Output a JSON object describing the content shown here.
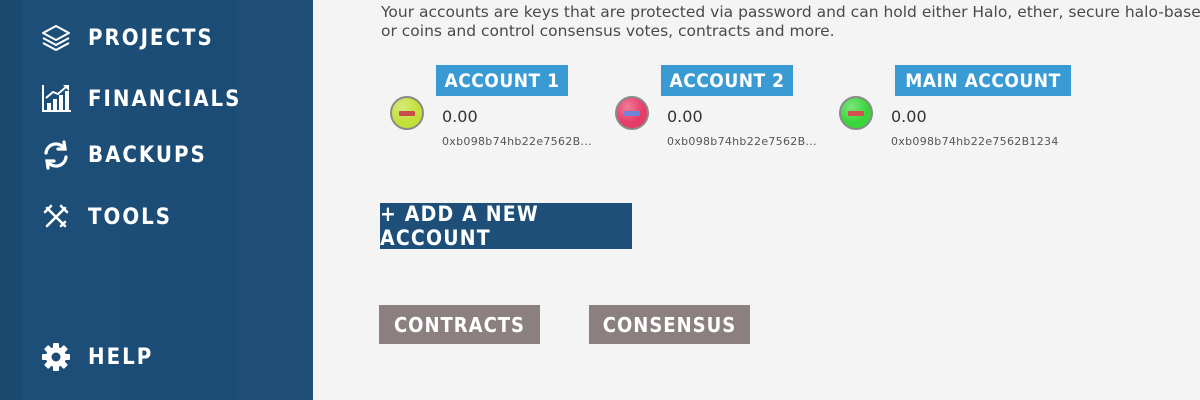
{
  "sidebar": {
    "items": [
      {
        "label": "PROJECTS",
        "icon": "layers-icon"
      },
      {
        "label": "FINANCIALS",
        "icon": "bar-chart-icon"
      },
      {
        "label": "BACKUPS",
        "icon": "refresh-icon"
      },
      {
        "label": "TOOLS",
        "icon": "tools-icon"
      },
      {
        "label": "HELP",
        "icon": "gear-icon"
      }
    ]
  },
  "main": {
    "intro_line1": "Your accounts are keys that are protected via password and can hold either Halo, ether, secure halo-base",
    "intro_line2": "or coins and control consensus votes, contracts and more.",
    "accounts": [
      {
        "title": "ACCOUNT 1",
        "balance": "0.00",
        "address": "0xb098b74hb22e7562B...",
        "coin_color": "#c2e038",
        "stripe_color": "#c94e4e"
      },
      {
        "title": "ACCOUNT 2",
        "balance": "0.00",
        "address": "0xb098b74hb22e7562B...",
        "coin_color": "#e63c67",
        "stripe_color": "#6f86d8"
      },
      {
        "title": "MAIN ACCOUNT",
        "balance": "0.00",
        "address": "0xb098b74hb22e7562B1234",
        "coin_color": "#39d63b",
        "stripe_color": "#d65050"
      }
    ],
    "add_account_label": "+ ADD A NEW ACCOUNT",
    "contracts_label": "CONTRACTS",
    "consensus_label": "CONSENSUS"
  },
  "colors": {
    "sidebar_bg": "#1d4f79",
    "account_title_bg": "#3a9bd4",
    "add_button_bg": "#1d4f79",
    "gray_button_bg": "#8c7f80",
    "page_bg": "#f4f4f4"
  }
}
